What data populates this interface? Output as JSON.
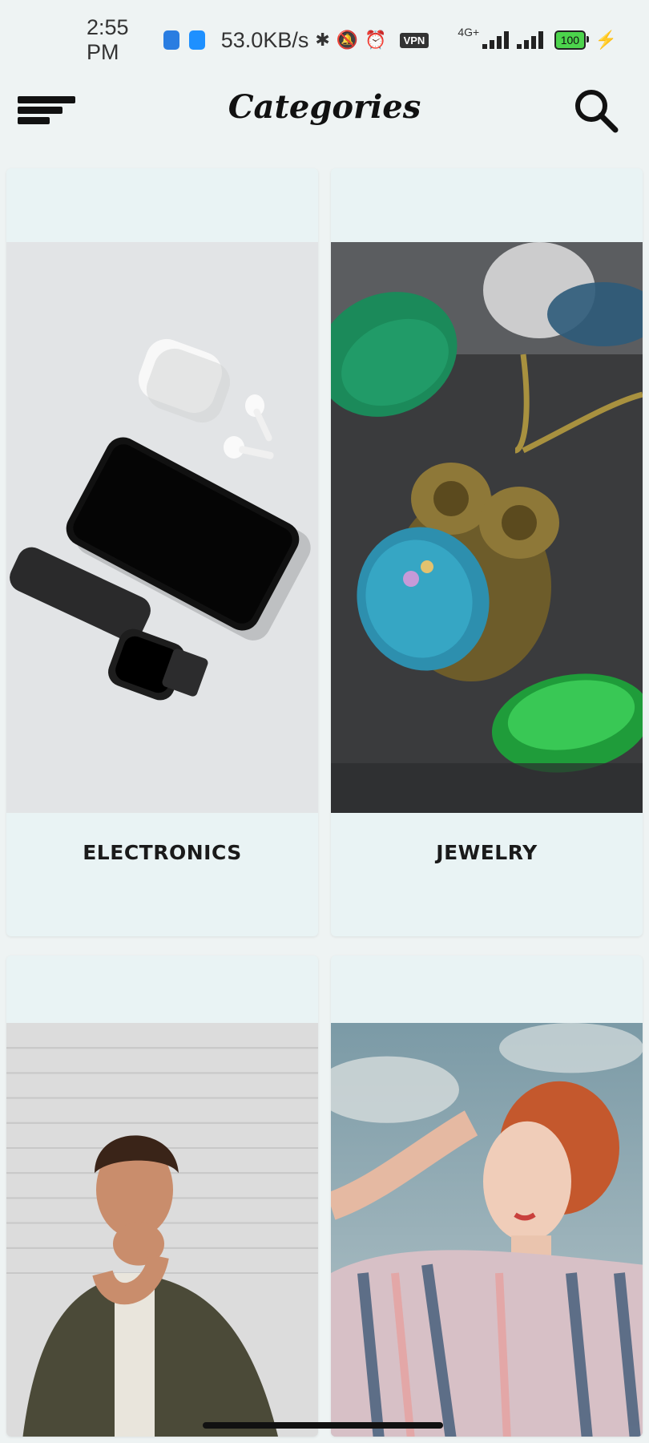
{
  "status_bar": {
    "time": "2:55 PM",
    "speed": "53.0KB/s",
    "network": "4G+",
    "battery": "100",
    "vpn": "VPN",
    "icons": [
      "bluetooth-icon",
      "mute-icon",
      "alarm-icon",
      "charging-icon"
    ]
  },
  "app_bar": {
    "title": "Categories"
  },
  "categories": [
    {
      "label": "ELECTRONICS"
    },
    {
      "label": "JEWELRY"
    },
    {
      "label": ""
    },
    {
      "label": ""
    }
  ],
  "colors": {
    "background": "#eef3f3",
    "card": "#e9f3f4",
    "text": "#1a1a1a"
  }
}
